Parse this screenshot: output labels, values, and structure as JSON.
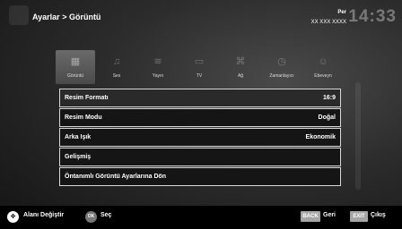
{
  "header": {
    "title": "Ayarlar > Görüntü"
  },
  "clock": {
    "day": "Per",
    "date": "XX XXX XXXX",
    "time": "14:33"
  },
  "tabs": [
    {
      "label": "Görüntü",
      "icon": "picture-icon",
      "glyph": "▦"
    },
    {
      "label": "Ses",
      "icon": "sound-icon",
      "glyph": "♫"
    },
    {
      "label": "Yayın",
      "icon": "broadcast-icon",
      "glyph": "≋"
    },
    {
      "label": "TV",
      "icon": "tv-icon",
      "glyph": "▭"
    },
    {
      "label": "Ağ",
      "icon": "network-icon",
      "glyph": "⌘"
    },
    {
      "label": "Zamanlayıcı",
      "icon": "timer-icon",
      "glyph": "◷"
    },
    {
      "label": "Ebeveyn",
      "icon": "parental-icon",
      "glyph": "☺"
    }
  ],
  "menu": [
    {
      "label": "Resim Formatı",
      "value": "16:9"
    },
    {
      "label": "Resim Modu",
      "value": "Doğal"
    },
    {
      "label": "Arka Işık",
      "value": "Ekonomik"
    },
    {
      "label": "Gelişmiş",
      "value": ""
    },
    {
      "label": "Öntanımlı Görüntü Ayarlarına Dön",
      "value": ""
    }
  ],
  "footer": {
    "nav_label": "Alanı Değiştir",
    "ok_key": "OK",
    "ok_label": "Seç",
    "back_key": "BACK",
    "back_label": "Geri",
    "exit_key": "EXIT",
    "exit_label": "Çıkış"
  },
  "colors": {
    "key_bg": "#a5a5a5",
    "row_border": "#d8d8d8"
  }
}
